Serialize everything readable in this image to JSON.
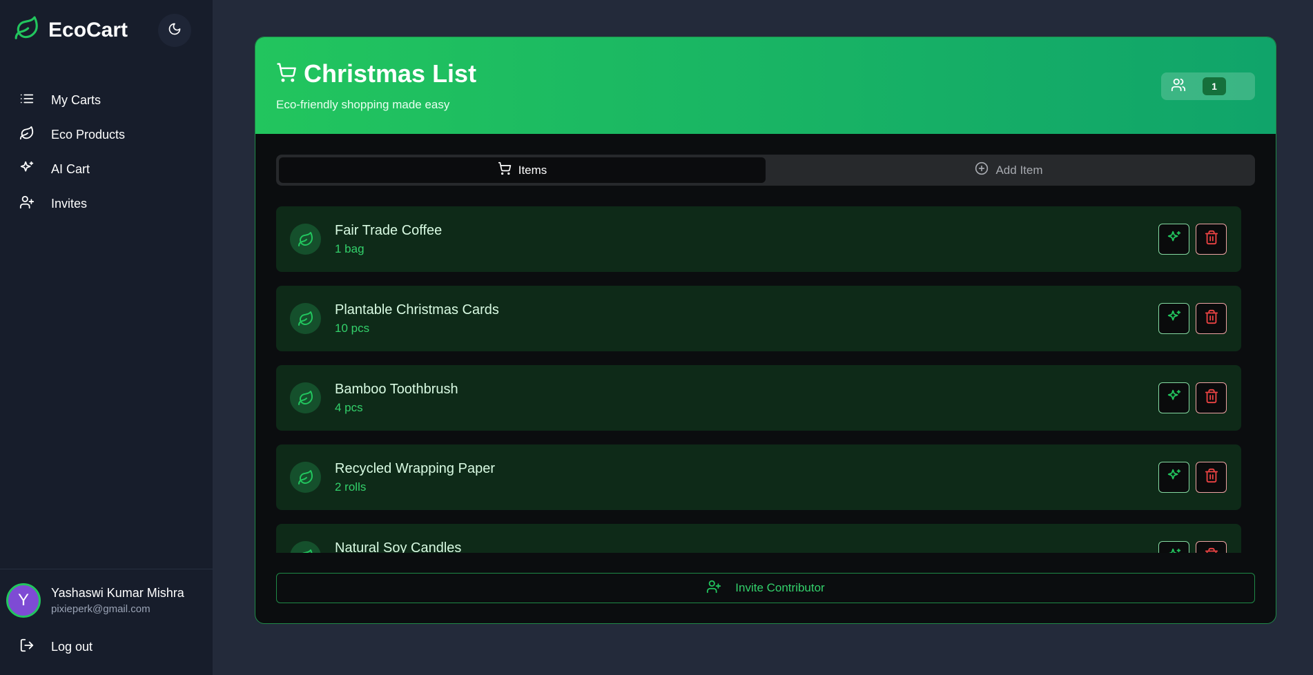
{
  "app": {
    "name": "EcoCart"
  },
  "sidebar": {
    "items": [
      {
        "label": "My Carts",
        "icon": "list-icon"
      },
      {
        "label": "Eco Products",
        "icon": "leaf-icon"
      },
      {
        "label": "AI Cart",
        "icon": "sparkles-icon"
      },
      {
        "label": "Invites",
        "icon": "user-plus-icon"
      }
    ],
    "user": {
      "initial": "Y",
      "name": "Yashaswi Kumar Mishra",
      "email": "pixieperk@gmail.com"
    },
    "logout_label": "Log out"
  },
  "cart": {
    "title": "Christmas List",
    "subtitle": "Eco-friendly shopping made easy",
    "contributors_count": "1"
  },
  "tabs": [
    {
      "label": "Items",
      "active": true
    },
    {
      "label": "Add Item",
      "active": false
    }
  ],
  "items": [
    {
      "name": "Fair Trade Coffee",
      "qty": "1 bag"
    },
    {
      "name": "Plantable Christmas Cards",
      "qty": "10 pcs"
    },
    {
      "name": "Bamboo Toothbrush",
      "qty": "4 pcs"
    },
    {
      "name": "Recycled Wrapping Paper",
      "qty": "2 rolls"
    },
    {
      "name": "Natural Soy Candles",
      "qty": ""
    }
  ],
  "invite_label": "Invite Contributor",
  "colors": {
    "accent": "#22c55e",
    "sidebar_bg": "#171d2b",
    "page_bg": "#232a3a",
    "item_bg": "#0e2a18",
    "danger": "#ef4444"
  }
}
